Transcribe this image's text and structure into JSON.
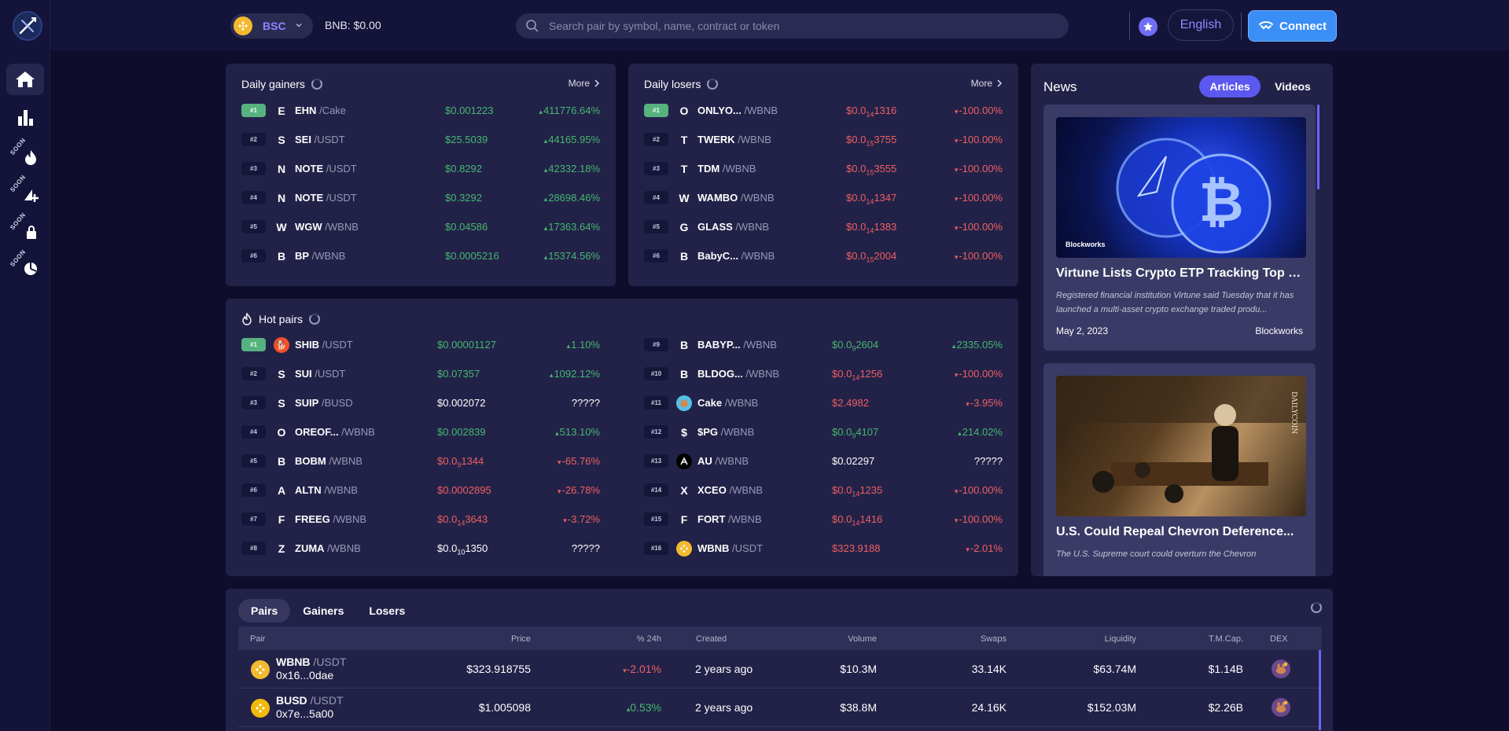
{
  "header": {
    "chain": "BSC",
    "balance": "BNB: $0.00",
    "search_placeholder": "Search pair by symbol, name, contract or token",
    "language": "English",
    "connect": "Connect"
  },
  "sidebar": {
    "soon_label": "SOON"
  },
  "daily_gainers": {
    "title": "Daily gainers",
    "more": "More",
    "rows": [
      {
        "rank": "#1",
        "letter": "E",
        "symbol": "EHN",
        "quote": " /Cake",
        "price": "$0.001223",
        "change": "411776.64%"
      },
      {
        "rank": "#2",
        "letter": "S",
        "symbol": "SEI",
        "quote": " /USDT",
        "price": "$25.5039",
        "change": "44165.95%"
      },
      {
        "rank": "#3",
        "letter": "N",
        "symbol": "NOTE",
        "quote": " /USDT",
        "price": "$0.8292",
        "change": "42332.18%"
      },
      {
        "rank": "#4",
        "letter": "N",
        "symbol": "NOTE",
        "quote": " /USDT",
        "price": "$0.3292",
        "change": "28698.46%"
      },
      {
        "rank": "#5",
        "letter": "W",
        "symbol": "WGW",
        "quote": " /WBNB",
        "price": "$0.04586",
        "change": "17363.64%"
      },
      {
        "rank": "#6",
        "letter": "B",
        "symbol": "BP",
        "quote": " /WBNB",
        "price": "$0.0005216",
        "change": "15374.56%"
      }
    ]
  },
  "daily_losers": {
    "title": "Daily losers",
    "more": "More",
    "rows": [
      {
        "rank": "#1",
        "letter": "O",
        "symbol": "ONLYO...",
        "quote": " /WBNB",
        "price_a": "$0.0",
        "price_sub": "14",
        "price_b": "1316",
        "change": "-100.00%"
      },
      {
        "rank": "#2",
        "letter": "T",
        "symbol": "TWERK",
        "quote": " /WBNB",
        "price_a": "$0.0",
        "price_sub": "15",
        "price_b": "3755",
        "change": "-100.00%"
      },
      {
        "rank": "#3",
        "letter": "T",
        "symbol": "TDM",
        "quote": " /WBNB",
        "price_a": "$0.0",
        "price_sub": "15",
        "price_b": "3555",
        "change": "-100.00%"
      },
      {
        "rank": "#4",
        "letter": "W",
        "symbol": "WAMBO",
        "quote": " /WBNB",
        "price_a": "$0.0",
        "price_sub": "14",
        "price_b": "1347",
        "change": "-100.00%"
      },
      {
        "rank": "#5",
        "letter": "G",
        "symbol": "GLASS",
        "quote": " /WBNB",
        "price_a": "$0.0",
        "price_sub": "14",
        "price_b": "1383",
        "change": "-100.00%"
      },
      {
        "rank": "#6",
        "letter": "B",
        "symbol": "BabyC...",
        "quote": " /WBNB",
        "price_a": "$0.0",
        "price_sub": "15",
        "price_b": "2004",
        "change": "-100.00%"
      }
    ]
  },
  "hot_pairs": {
    "title": "Hot pairs",
    "left": [
      {
        "rank": "#1",
        "letter": "",
        "icon": "shib",
        "symbol": "SHIB",
        "quote": " /USDT",
        "price": "$0.00001127",
        "color": "green",
        "change": "1.10%",
        "dir": "up"
      },
      {
        "rank": "#2",
        "letter": "S",
        "symbol": "SUI",
        "quote": " /USDT",
        "price": "$0.07357",
        "color": "green",
        "change": "1092.12%",
        "dir": "up"
      },
      {
        "rank": "#3",
        "letter": "S",
        "symbol": "SUIP",
        "quote": " /BUSD",
        "price": "$0.002072",
        "color": "white",
        "change": "?????",
        "dir": "none"
      },
      {
        "rank": "#4",
        "letter": "O",
        "symbol": "OREOF...",
        "quote": " /WBNB",
        "price": "$0.002839",
        "color": "green",
        "change": "513.10%",
        "dir": "up"
      },
      {
        "rank": "#5",
        "letter": "B",
        "symbol": "BOBM",
        "quote": " /WBNB",
        "price": "$0.0",
        "sub": "9",
        "price_b": "1344",
        "color": "red",
        "change": "-65.76%",
        "dir": "down"
      },
      {
        "rank": "#6",
        "letter": "A",
        "symbol": "ALTN",
        "quote": " /WBNB",
        "price": "$0.0002895",
        "color": "red",
        "change": "-26.78%",
        "dir": "down"
      },
      {
        "rank": "#7",
        "letter": "F",
        "symbol": "FREEG",
        "quote": " /WBNB",
        "price": "$0.0",
        "sub": "14",
        "price_b": "3643",
        "color": "red",
        "change": "-3.72%",
        "dir": "down"
      },
      {
        "rank": "#8",
        "letter": "Z",
        "symbol": "ZUMA",
        "quote": " /WBNB",
        "price": "$0.0",
        "sub": "10",
        "price_b": "1350",
        "color": "white",
        "change": "?????",
        "dir": "none"
      }
    ],
    "right": [
      {
        "rank": "#9",
        "letter": "B",
        "symbol": "BABYP...",
        "quote": " /WBNB",
        "price": "$0.0",
        "sub": "9",
        "price_b": "2604",
        "color": "green",
        "change": "2335.05%",
        "dir": "up"
      },
      {
        "rank": "#10",
        "letter": "B",
        "symbol": "BLDOG...",
        "quote": " /WBNB",
        "price": "$0.0",
        "sub": "14",
        "price_b": "1256",
        "color": "red",
        "change": "-100.00%",
        "dir": "down"
      },
      {
        "rank": "#11",
        "letter": "",
        "icon": "cake",
        "symbol": "Cake",
        "quote": " /WBNB",
        "price": "$2.4982",
        "color": "red",
        "change": "-3.95%",
        "dir": "down"
      },
      {
        "rank": "#12",
        "letter": "$",
        "symbol": "$PG",
        "quote": " /WBNB",
        "price": "$0.0",
        "sub": "9",
        "price_b": "4107",
        "color": "green",
        "change": "214.02%",
        "dir": "up"
      },
      {
        "rank": "#13",
        "letter": "",
        "icon": "au",
        "symbol": "AU",
        "quote": " /WBNB",
        "price": "$0.02297",
        "color": "white",
        "change": "?????",
        "dir": "none"
      },
      {
        "rank": "#14",
        "letter": "X",
        "symbol": "XCEO",
        "quote": " /WBNB",
        "price": "$0.0",
        "sub": "14",
        "price_b": "1235",
        "color": "red",
        "change": "-100.00%",
        "dir": "down"
      },
      {
        "rank": "#15",
        "letter": "F",
        "symbol": "FORT",
        "quote": " /WBNB",
        "price": "$0.0",
        "sub": "14",
        "price_b": "1416",
        "color": "red",
        "change": "-100.00%",
        "dir": "down"
      },
      {
        "rank": "#16",
        "letter": "",
        "icon": "bnb",
        "symbol": "WBNB",
        "quote": " /USDT",
        "price": "$323.9188",
        "color": "red",
        "change": "-2.01%",
        "dir": "down"
      }
    ]
  },
  "news": {
    "title": "News",
    "tab_articles": "Articles",
    "tab_videos": "Videos",
    "items": [
      {
        "headline": "Virtune Lists Crypto ETP Tracking Top 10...",
        "desc": "Registered financial institution Virtune said Tuesday that it has launched a multi-asset crypto exchange traded produ...",
        "date": "May 2, 2023",
        "source": "Blockworks",
        "image_watermark": "Blockworks"
      },
      {
        "headline": "U.S. Could Repeal Chevron Deference...",
        "desc": "The U.S. Supreme court could overturn the Chevron",
        "image_watermark": "DAILYCOIN"
      }
    ]
  },
  "pairs_table": {
    "tabs": [
      "Pairs",
      "Gainers",
      "Losers"
    ],
    "columns": [
      "Pair",
      "Price",
      "% 24h",
      "Created",
      "Volume",
      "Swaps",
      "Liquidity",
      "T.M.Cap.",
      "DEX"
    ],
    "rows": [
      {
        "symbol": "WBNB",
        "quote": " /USDT",
        "address": "0x16...0dae",
        "price": "$323.918755",
        "change": "-2.01%",
        "dir": "down",
        "created": "2 years ago",
        "volume": "$10.3M",
        "swaps": "33.14K",
        "liquidity": "$63.74M",
        "mcap": "$1.14B",
        "coin_color": "#f3ba2f"
      },
      {
        "symbol": "BUSD",
        "quote": " /USDT",
        "address": "0x7e...5a00",
        "price": "$1.005098",
        "change": "0.53%",
        "dir": "up",
        "created": "2 years ago",
        "volume": "$38.8M",
        "swaps": "24.16K",
        "liquidity": "$152.03M",
        "mcap": "$2.26B",
        "coin_color": "#f0b90b"
      }
    ]
  }
}
